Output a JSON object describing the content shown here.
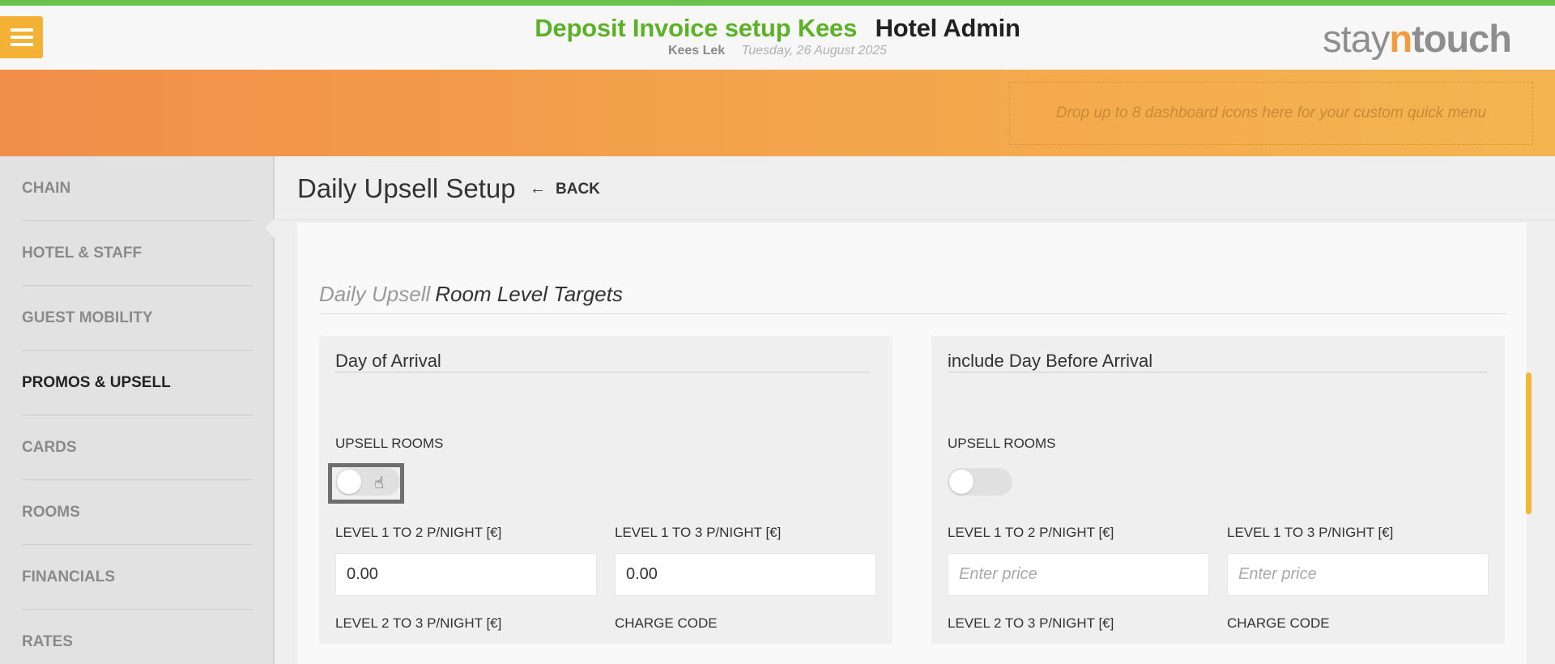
{
  "header": {
    "hotel_name": "Deposit Invoice setup Kees",
    "app_title": "Hotel Admin",
    "user_name": "Kees Lek",
    "date": "Tuesday, 26 August 2025",
    "logo": {
      "part1": "stay",
      "part2": "n",
      "part3": "touch"
    },
    "menu_icon": "hamburger-icon"
  },
  "banner": {
    "dropzone_text": "Drop up to 8 dashboard icons here for your custom quick menu"
  },
  "sidebar": {
    "items": [
      {
        "label": "CHAIN",
        "active": false
      },
      {
        "label": "HOTEL & STAFF",
        "active": false
      },
      {
        "label": "GUEST MOBILITY",
        "active": false
      },
      {
        "label": "PROMOS & UPSELL",
        "active": true
      },
      {
        "label": "CARDS",
        "active": false
      },
      {
        "label": "ROOMS",
        "active": false
      },
      {
        "label": "FINANCIALS",
        "active": false
      },
      {
        "label": "RATES",
        "active": false
      }
    ]
  },
  "main": {
    "title": "Daily Upsell Setup",
    "back_label": "BACK",
    "section": {
      "light": "Daily Upsell",
      "dark": "Room Level Targets"
    },
    "panels": [
      {
        "title": "Day of Arrival",
        "upsell_label": "UPSELL ROOMS",
        "upsell_on": false,
        "level_1_2_label": "LEVEL 1 TO 2 P/NIGHT [€]",
        "level_1_2_value": "0.00",
        "level_1_3_label": "LEVEL 1 TO 3 P/NIGHT [€]",
        "level_1_3_value": "0.00",
        "level_2_3_label": "LEVEL 2 TO 3 P/NIGHT [€]",
        "charge_code_label": "CHARGE CODE"
      },
      {
        "title": "include Day Before Arrival",
        "upsell_label": "UPSELL ROOMS",
        "upsell_on": false,
        "level_1_2_label": "LEVEL 1 TO 2 P/NIGHT [€]",
        "level_1_2_placeholder": "Enter price",
        "level_1_3_label": "LEVEL 1 TO 3 P/NIGHT [€]",
        "level_1_3_placeholder": "Enter price",
        "level_2_3_label": "LEVEL 2 TO 3 P/NIGHT [€]",
        "charge_code_label": "CHARGE CODE"
      }
    ]
  },
  "colors": {
    "accent_green": "#5cb227",
    "banner_orange": "#f18e4a",
    "menu_yellow": "#f3b236"
  }
}
